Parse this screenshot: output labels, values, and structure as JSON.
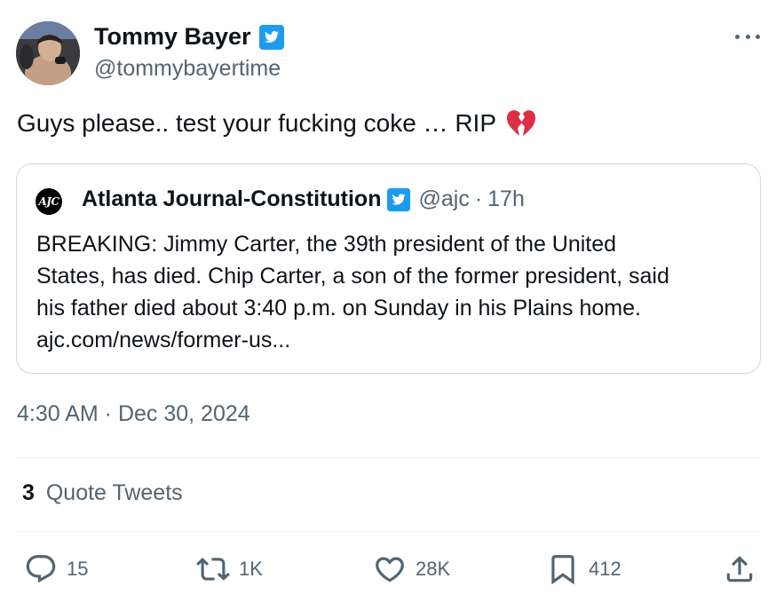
{
  "author": {
    "name": "Tommy Bayer",
    "handle": "@tommybayertime"
  },
  "tweet": {
    "text": "Guys please.. test your fucking coke … RIP",
    "emoji": "💔",
    "timestamp": "4:30 AM · Dec 30, 2024"
  },
  "quoted": {
    "logo_text": "AJC",
    "name": "Atlanta Journal-Constitution",
    "handle": "@ajc",
    "separator": "·",
    "time": "17h",
    "lines": [
      "BREAKING: Jimmy Carter, the 39th president of the United",
      "States, has died. Chip Carter, a son of the former president, said",
      "his father died about 3:40 p.m. on Sunday in his Plains home.",
      "ajc.com/news/former-us..."
    ]
  },
  "quote_tweets": {
    "count": "3",
    "label": "Quote Tweets"
  },
  "actions": {
    "replies": "15",
    "retweets": "1K",
    "likes": "28K",
    "bookmarks": "412"
  },
  "colors": {
    "verified_blue": "#1d9bf0",
    "secondary_text": "#536471",
    "primary_text": "#0f1419",
    "border": "#cfd9de",
    "heart_broken": "#dd2e44"
  },
  "icons": {
    "verified": "verified-badge-icon",
    "more": "more-icon",
    "reply": "reply-icon",
    "retweet": "retweet-icon",
    "like": "heart-icon",
    "bookmark": "bookmark-icon",
    "share": "share-icon"
  }
}
